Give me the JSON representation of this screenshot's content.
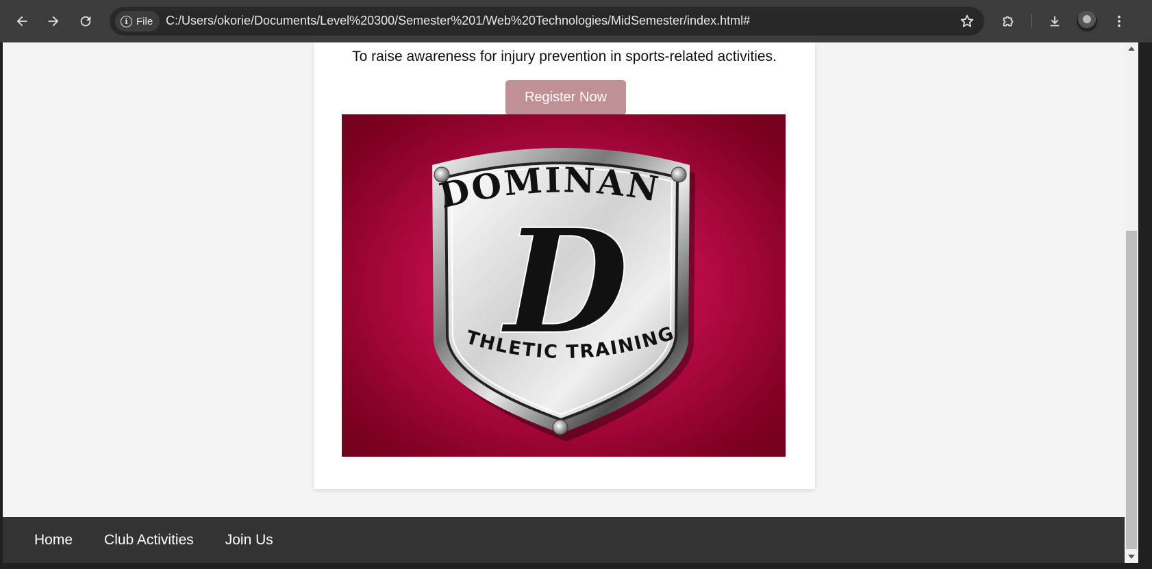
{
  "browser": {
    "back_icon": "arrow-left-icon",
    "forward_icon": "arrow-right-icon",
    "reload_icon": "reload-icon",
    "site_chip_label": "File",
    "url": "C:/Users/okorie/Documents/Level%20300/Semester%201/Web%20Technologies/MidSemester/index.html#",
    "bookmark_icon": "star-icon",
    "extensions_icon": "puzzle-icon",
    "download_icon": "download-icon",
    "menu_icon": "kebab-menu-icon"
  },
  "page": {
    "tagline": "To raise awareness for injury prevention in sports-related activities.",
    "register_button": "Register Now",
    "register_button_color": "#c09095",
    "logo": {
      "top_text": "DOMINANT",
      "letter": "D",
      "bottom_text": "ATHLETIC TRAINING",
      "background_color": "#b60a45"
    }
  },
  "footer_nav": {
    "items": [
      "Home",
      "Club Activities",
      "Join Us"
    ],
    "background": "#333333"
  }
}
